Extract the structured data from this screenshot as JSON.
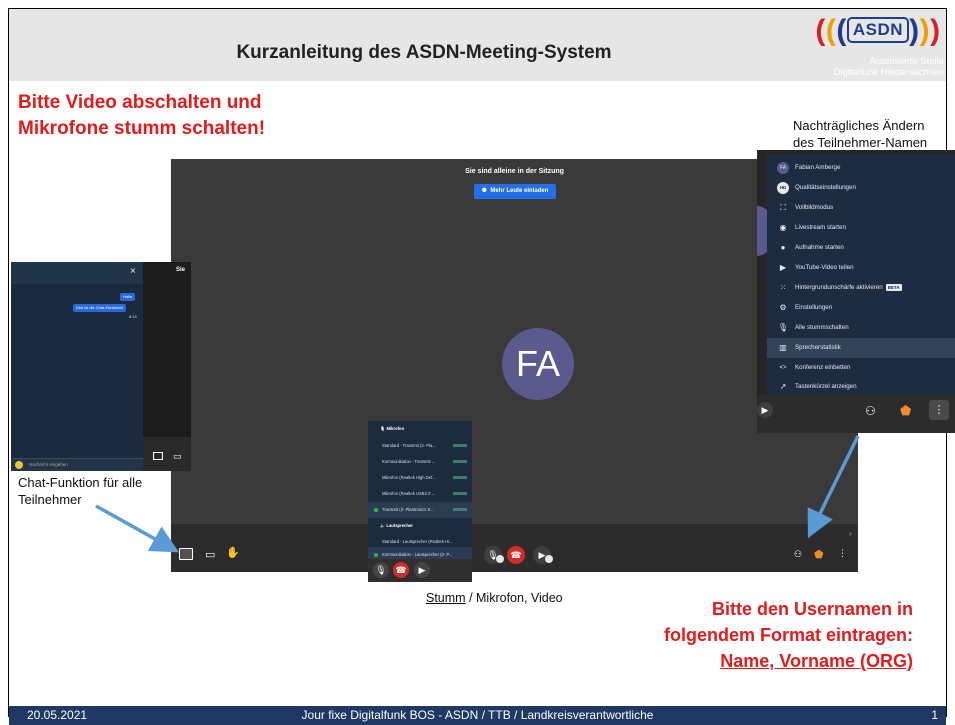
{
  "header": {
    "title": "Kurzanleitung des ASDN-Meeting-System",
    "logo_text": "ASDN",
    "logo_sub1": "Autorisierte Stelle",
    "logo_sub2": "Digitalfunk Niedersachsen"
  },
  "notes": {
    "warning_top_line1": "Bitte Video abschalten und",
    "warning_top_line2": "Mikrofone  stumm schalten!",
    "names_caption_line1": "Nachträgliches Ändern",
    "names_caption_line2": "des Teilnehmer-Namen",
    "chat_caption_line1": "Chat-Funktion für alle",
    "chat_caption_line2": "Teilnehmer",
    "stumm_word": "Stumm",
    "stumm_rest": " / Mikrofon, Video",
    "warning_bottom_line1": "Bitte den Usernamen in",
    "warning_bottom_line2": "folgendem Format eintragen:",
    "warning_bottom_line3": "Name, Vorname (ORG)"
  },
  "meeting": {
    "alone_text": "Sie sind alleine in der Sitzung",
    "invite_button": "Mehr Leute einladen",
    "avatar_initials": "FA"
  },
  "chat": {
    "close_glyph": "×",
    "msg1": "Hallo",
    "msg2": "Des ist die Chat-Funktion!!",
    "time": "8:15",
    "input_placeholder": "Nachricht eingeben",
    "side_text": "Sie"
  },
  "mic_menu": {
    "mic_header": "Mikrofon",
    "mic_items": [
      "Standard - Transmit (2- Pla...",
      "Kommunikation - Transmit ...",
      "Mikrofon (Realtek High Def...",
      "Mikrofon (Realtek USB2.0 ...",
      "Transmit (2- Plantronics S..."
    ],
    "speaker_header": "Lautsprecher",
    "speaker_items": [
      "Standard - Lautsprecher (Realtek Hi...",
      "Kommunikation - Lautsprecher (2- P..."
    ]
  },
  "more_menu": {
    "items": [
      {
        "icon": "FA",
        "label": "Fabian Amberge"
      },
      {
        "icon": "HD",
        "label": "Qualitätseinstellungen"
      },
      {
        "icon": "⛶",
        "label": "Vollbildmodus"
      },
      {
        "icon": "◉",
        "label": "Livestream starten"
      },
      {
        "icon": "●",
        "label": "Aufnahme starten"
      },
      {
        "icon": "▶",
        "label": "YouTube-Video teilen"
      },
      {
        "icon": "⁙",
        "label": "Hintergrundunschärfe aktivieren"
      },
      {
        "icon": "⚙",
        "label": "Einstellungen"
      },
      {
        "icon": "🎙",
        "label": "Alle stummschalten"
      },
      {
        "icon": "▥",
        "label": "Sprecherstatistik"
      },
      {
        "icon": "<>",
        "label": "Konferenz einbetten"
      },
      {
        "icon": "↗",
        "label": "Tastenkürzel anzeigen"
      }
    ],
    "beta_label": "BETA"
  },
  "footer": {
    "date": "20.05.2021",
    "center": "Jour fixe Digitalfunk BOS - ASDN / TTB / Landkreisverantwortliche",
    "page": "1"
  },
  "colors": {
    "warning_red": "#e31b1b",
    "footer_blue": "#1f3864",
    "arrow_blue": "#5b9bd5"
  }
}
